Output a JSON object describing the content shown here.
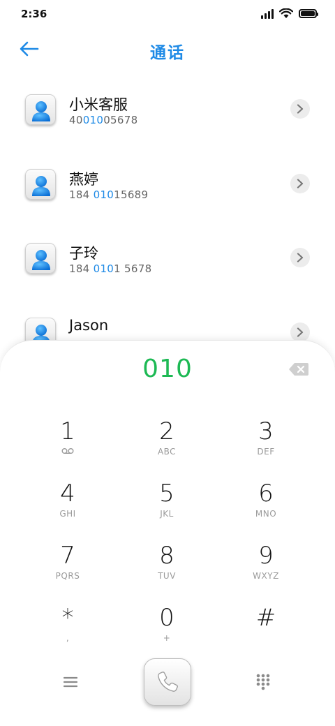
{
  "status_bar": {
    "time": "2:36"
  },
  "header": {
    "title": "通话"
  },
  "contacts": [
    {
      "name": "小米客服",
      "number_pre": "40",
      "number_hl": "010",
      "number_post": "05678"
    },
    {
      "name": "燕婷",
      "number_pre": "184 ",
      "number_hl": "010",
      "number_post": "15689"
    },
    {
      "name": "子玲",
      "number_pre": "184 ",
      "number_hl": "010",
      "number_post": "1 5678"
    },
    {
      "name": "Jason",
      "number_pre": "",
      "number_hl": "",
      "number_post": ""
    }
  ],
  "dialpad": {
    "number": "010",
    "keys": [
      {
        "digit": "1",
        "sub": ""
      },
      {
        "digit": "2",
        "sub": "ABC"
      },
      {
        "digit": "3",
        "sub": "DEF"
      },
      {
        "digit": "4",
        "sub": "GHI"
      },
      {
        "digit": "5",
        "sub": "JKL"
      },
      {
        "digit": "6",
        "sub": "MNO"
      },
      {
        "digit": "7",
        "sub": "PQRS"
      },
      {
        "digit": "8",
        "sub": "TUV"
      },
      {
        "digit": "9",
        "sub": "WXYZ"
      },
      {
        "digit": "*",
        "sub": ","
      },
      {
        "digit": "0",
        "sub": "+"
      },
      {
        "digit": "#",
        "sub": ""
      }
    ]
  },
  "colors": {
    "accent": "#1e8ae6",
    "dial_number": "#1db954"
  }
}
